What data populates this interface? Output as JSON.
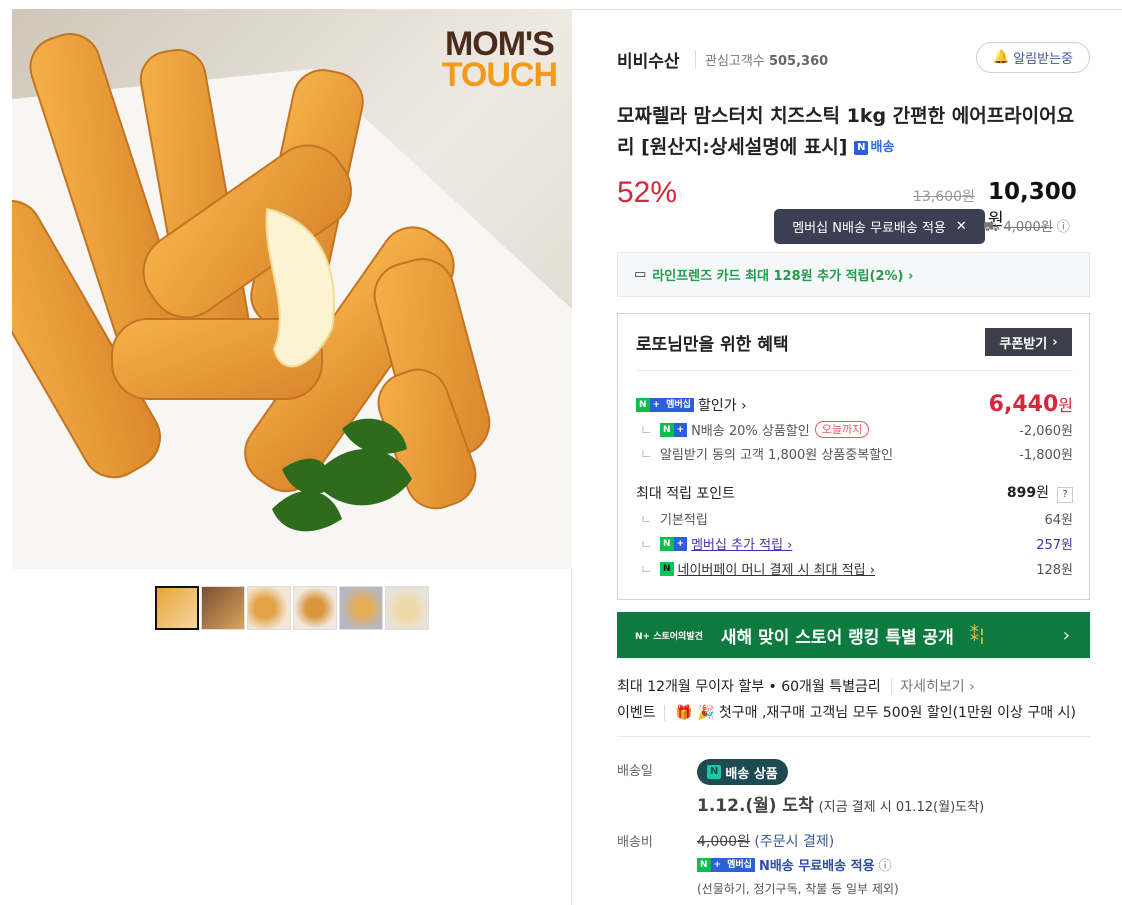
{
  "product_image": {
    "brand_logo_line1": "MOM'S",
    "brand_logo_line2": "TOUCH",
    "alt": "cheese-sticks"
  },
  "thumbnails": [
    "thumb-1",
    "thumb-2",
    "thumb-3",
    "thumb-4",
    "thumb-5",
    "thumb-6"
  ],
  "seller": {
    "name": "비비수산",
    "fav_label": "관심고객수",
    "fav_count": "505,360",
    "alarm_label": "알림받는중"
  },
  "product": {
    "title": "모짜렐라 맘스터치 치즈스틱 1kg 간편한 에어프라이어요리 [원산지:상세설명에 표시]",
    "delivery_badge": "배송",
    "discount_rate": "52%",
    "original_price": "13,600원",
    "price": "10,300",
    "price_unit": "원",
    "tooltip": "멤버십 N배송 무료배송 적용",
    "shipping_fee_strike": "4,000원"
  },
  "card_promo": "라인프렌즈 카드 최대 128원 추가 적립(2%) ›",
  "benefit": {
    "title": "로또님만을 위한 혜택",
    "coupon_button": "쿠폰받기",
    "membership_badge": "멤버십",
    "sale_label": "할인가 ›",
    "sale_price": "6,440",
    "sale_unit": "원",
    "discount_rows": [
      {
        "label": "N배송 20% 상품할인",
        "tag": "오늘까지",
        "value": "-2,060원"
      },
      {
        "label": "알림받기 동의 고객 1,800원 상품중복할인",
        "value": "-1,800원"
      }
    ],
    "point_title": "최대 적립 포인트",
    "point_total": "899",
    "point_unit": "원",
    "point_help": "?",
    "point_rows": [
      {
        "label": "기본적립",
        "value": "64원"
      },
      {
        "label": "멤버십 추가 적립 ›",
        "value": "257원"
      },
      {
        "label": "네이버페이 머니 결제 시 최대 적립 ›",
        "value": "128원"
      }
    ]
  },
  "banner": {
    "small": "N+ 스토어의발견",
    "text": "새해 맞이 스토어 랭킹 특별 공개",
    "arrow": "›"
  },
  "installment": {
    "text": "최대 12개월 무이자 할부 • 60개월 특별금리",
    "link": "자세히보기 ›"
  },
  "event": {
    "label": "이벤트",
    "text": "🎁 🎉 첫구매 ,재구매 고객님 모두 500원 할인(1만원 이상 구매 시)"
  },
  "delivery": {
    "date_label": "배송일",
    "n_delivery": "배송 상품",
    "arrival": "1.12.(월) 도착",
    "arrival_note": "(지금 결제 시 01.12(월)도착)",
    "fee_label": "배송비",
    "fee_strike": "4,000원",
    "fee_note": "(주문시 결제)",
    "free_text": "N배송 무료배송 적용",
    "exclude_note": "(선물하기, 정기구독, 착불 등 일부 제외)"
  },
  "colors": {
    "discount_red": "#d6283a",
    "naver_green": "#0dbf4a",
    "naver_blue": "#2b60d8",
    "banner_green": "#0d7a3f"
  }
}
